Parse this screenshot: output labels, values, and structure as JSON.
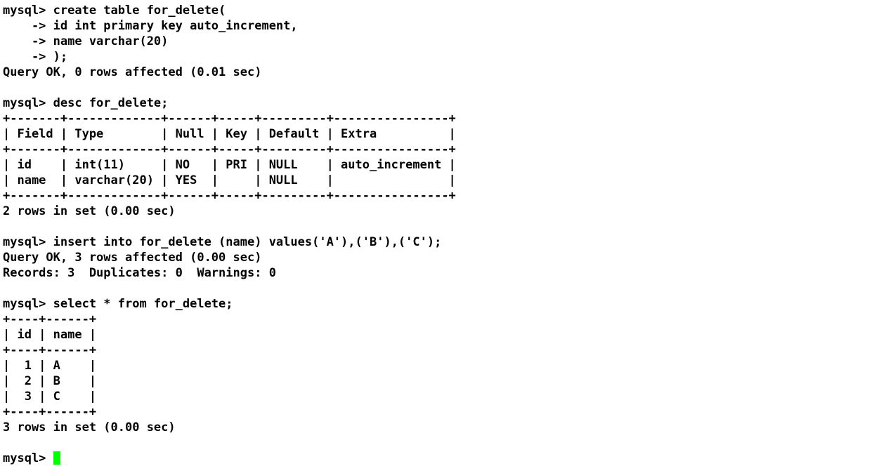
{
  "terminal": {
    "app": "mysql-client-terminal",
    "background_color": "#ffffff",
    "foreground_color": "#000000",
    "cursor_color": "#00ff00",
    "prompt": "mysql>",
    "continuation_prompt": "->",
    "lines": [
      "mysql> create table for_delete(",
      "    -> id int primary key auto_increment,",
      "    -> name varchar(20)",
      "    -> );",
      "Query OK, 0 rows affected (0.01 sec)",
      "",
      "mysql> desc for_delete;",
      "+-------+-------------+------+-----+---------+----------------+",
      "| Field | Type        | Null | Key | Default | Extra          |",
      "+-------+-------------+------+-----+---------+----------------+",
      "| id    | int(11)     | NO   | PRI | NULL    | auto_increment |",
      "| name  | varchar(20) | YES  |     | NULL    |                |",
      "+-------+-------------+------+-----+---------+----------------+",
      "2 rows in set (0.00 sec)",
      "",
      "mysql> insert into for_delete (name) values('A'),('B'),('C');",
      "Query OK, 3 rows affected (0.00 sec)",
      "Records: 3  Duplicates: 0  Warnings: 0",
      "",
      "mysql> select * from for_delete;",
      "+----+------+",
      "| id | name |",
      "+----+------+",
      "|  1 | A    |",
      "|  2 | B    |",
      "|  3 | C    |",
      "+----+------+",
      "3 rows in set (0.00 sec)",
      ""
    ],
    "final_prompt": "mysql> ",
    "statements": [
      {
        "command": "create table for_delete(\n    -> id int primary key auto_increment,\n    -> name varchar(20)\n    -> );",
        "result": "Query OK, 0 rows affected (0.01 sec)"
      },
      {
        "command": "desc for_delete;",
        "result": "2 rows in set (0.00 sec)"
      },
      {
        "command": "insert into for_delete (name) values('A'),('B'),('C');",
        "result": "Query OK, 3 rows affected (0.00 sec)\nRecords: 3  Duplicates: 0  Warnings: 0"
      },
      {
        "command": "select * from for_delete;",
        "result": "3 rows in set (0.00 sec)"
      }
    ],
    "describe_table": {
      "columns": [
        "Field",
        "Type",
        "Null",
        "Key",
        "Default",
        "Extra"
      ],
      "rows": [
        [
          "id",
          "int(11)",
          "NO",
          "PRI",
          "NULL",
          "auto_increment"
        ],
        [
          "name",
          "varchar(20)",
          "YES",
          "",
          "NULL",
          ""
        ]
      ],
      "row_count_text": "2 rows in set (0.00 sec)"
    },
    "select_table": {
      "columns": [
        "id",
        "name"
      ],
      "rows": [
        [
          "1",
          "A"
        ],
        [
          "2",
          "B"
        ],
        [
          "3",
          "C"
        ]
      ],
      "row_count_text": "3 rows in set (0.00 sec)"
    }
  }
}
